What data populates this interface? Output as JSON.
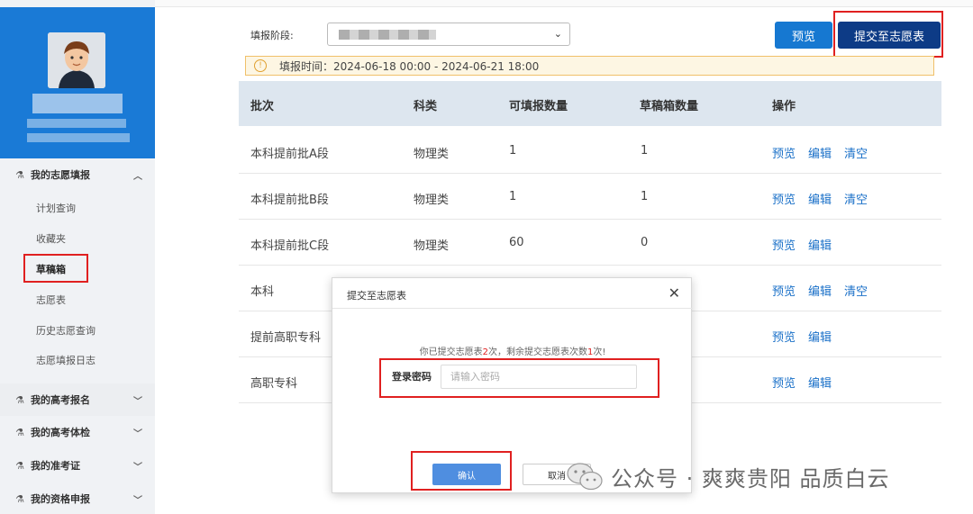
{
  "sidebar": {
    "groups": [
      {
        "label": "我的志愿填报",
        "expanded": true
      },
      {
        "label": "我的高考报名"
      },
      {
        "label": "我的高考体检"
      },
      {
        "label": "我的准考证"
      },
      {
        "label": "我的资格申报"
      }
    ],
    "sub_items": [
      "计划查询",
      "收藏夹",
      "草稿箱",
      "志愿表",
      "历史志愿查询",
      "志愿填报日志"
    ],
    "active_item": "草稿箱"
  },
  "toolbar": {
    "stage_label": "填报阶段:",
    "preview_label": "预览",
    "submit_label": "提交至志愿表"
  },
  "notice": {
    "text": "填报时间：2024-06-18 00:00 - 2024-06-21 18:00"
  },
  "table": {
    "headers": [
      "批次",
      "科类",
      "可填报数量",
      "草稿箱数量",
      "操作"
    ],
    "rows": [
      {
        "batch": "本科提前批A段",
        "type": "物理类",
        "fill": "1",
        "draft": "1",
        "ops": [
          "预览",
          "编辑",
          "清空"
        ]
      },
      {
        "batch": "本科提前批B段",
        "type": "物理类",
        "fill": "1",
        "draft": "1",
        "ops": [
          "预览",
          "编辑",
          "清空"
        ]
      },
      {
        "batch": "本科提前批C段",
        "type": "物理类",
        "fill": "60",
        "draft": "0",
        "ops": [
          "预览",
          "编辑"
        ]
      },
      {
        "batch": "本科",
        "type": "",
        "fill": "",
        "draft": "",
        "ops": [
          "预览",
          "编辑",
          "清空"
        ]
      },
      {
        "batch": "提前高职专科",
        "type": "",
        "fill": "",
        "draft": "",
        "ops": [
          "预览",
          "编辑"
        ]
      },
      {
        "batch": "高职专科",
        "type": "",
        "fill": "",
        "draft": "",
        "ops": [
          "预览",
          "编辑"
        ]
      }
    ]
  },
  "dialog": {
    "title": "提交至志愿表",
    "msg_part1": "你已提交志愿表",
    "msg_count_done": "2",
    "msg_part2": "次，剩余提交志愿表次数",
    "msg_count_left": "1",
    "msg_part3": "次!",
    "password_label": "登录密码",
    "password_placeholder": "请输入密码",
    "confirm_label": "确认",
    "cancel_label": "取消"
  },
  "watermark": {
    "text": "公众号 · 爽爽贵阳 品质白云"
  },
  "colors": {
    "profile_bg": "#1a7ad6",
    "primary_button": "#1678d1",
    "submit_button": "#0d3b86",
    "link": "#1a70c8",
    "highlight_box": "#e02020"
  }
}
